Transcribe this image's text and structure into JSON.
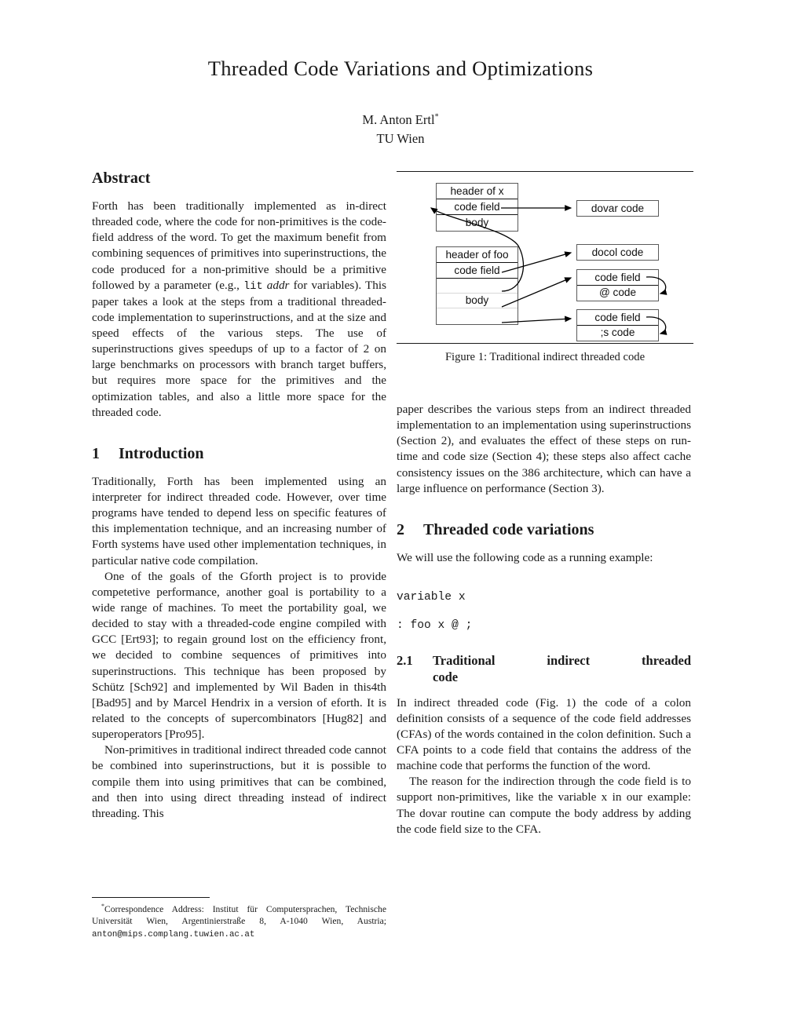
{
  "paper": {
    "title": "Threaded Code Variations and Optimizations",
    "author": "M. Anton Ertl",
    "author_marker": "*",
    "affiliation": "TU Wien"
  },
  "abstract": {
    "heading": "Abstract",
    "body_1": "Forth has been traditionally implemented as in-direct threaded code, where the code for non-primitives is the code-field address of the word. To get the maximum benefit from combining sequences of primitives into superinstructions, the code produced for a non-primitive should be a primitive followed by a parameter (e.g., ",
    "body_code": "lit",
    "body_italic": "addr",
    "body_2": " for variables). This paper takes a look at the steps from a traditional threaded-code implementation to superinstructions, and at the size and speed effects of the various steps. The use of superinstructions gives speedups of up to a factor of 2 on large benchmarks on processors with branch target buffers, but requires more space for the primitives and the optimization tables, and also a little more space for the threaded code."
  },
  "section1": {
    "number": "1",
    "heading": "Introduction",
    "para1": "Traditionally, Forth has been implemented using an interpreter for indirect threaded code. However, over time programs have tended to depend less on specific features of this implementation technique, and an increasing number of Forth systems have used other implementation techniques, in particular native code compilation.",
    "para2": "One of the goals of the Gforth project is to provide competetive performance, another goal is portability to a wide range of machines. To meet the portability goal, we decided to stay with a threaded-code engine compiled with GCC [Ert93]; to regain ground lost on the efficiency front, we decided to combine sequences of primitives into superinstructions. This technique has been proposed by Schütz [Sch92] and implemented by Wil Baden in this4th [Bad95] and by Marcel Hendrix in a version of eforth. It is related to the concepts of supercombinators [Hug82] and superoperators [Pro95].",
    "para3": "Non-primitives in traditional indirect threaded code cannot be combined into superinstructions, but it is possible to compile them into using primitives that can be combined, and then into using direct threading instead of indirect threading. This",
    "para3_cont": "paper describes the various steps from an indirect threaded implementation to an implementation using superinstructions (Section 2), and evaluates the effect of these steps on run-time and code size (Section 4); these steps also affect cache consistency issues on the 386 architecture, which can have a large influence on performance (Section 3)."
  },
  "footnote": {
    "marker": "*",
    "text_1": "Correspondence Address:  Institut für Computersprachen, Technische Universität Wien, Argentinierstraße 8, A-1040 Wien, Austria; ",
    "email": "anton@mips.complang.tuwien.ac.at"
  },
  "figure1": {
    "caption": "Figure 1: Traditional indirect threaded code",
    "boxes": {
      "x_header": "header of x",
      "x_code_field": "code field",
      "x_body": "body",
      "foo_header": "header of foo",
      "foo_code_field": "code field",
      "foo_body": "body",
      "dovar": "dovar code",
      "docol": "docol code",
      "at_code_field": "code field",
      "at_code": "@ code",
      "semis_code_field": "code field",
      "semis_code": ";s code"
    },
    "colors": {
      "box_border": "#5a5a5a",
      "cell_divider": "#111111",
      "light_divider": "#d8d8d8",
      "arrow": "#000000"
    }
  },
  "section2": {
    "number": "2",
    "heading": "Threaded code variations",
    "intro": "We will use the following code as a running example:",
    "code_line1": "variable x",
    "code_line2": ": foo x @ ;"
  },
  "section21": {
    "number": "2.1",
    "heading_line1": "Traditional    indirect    threaded",
    "heading_line2": "code",
    "para1": "In indirect threaded code (Fig. 1) the code of a colon definition consists of a sequence of the code field addresses (CFAs) of the words contained in the colon definition. Such a CFA points to a code field that contains the address of the machine code that performs the function of the word.",
    "para2": "The reason for the indirection through the code field is to support non-primitives, like the variable x in our example: The dovar routine can compute the body address by adding the code field size to the CFA."
  }
}
